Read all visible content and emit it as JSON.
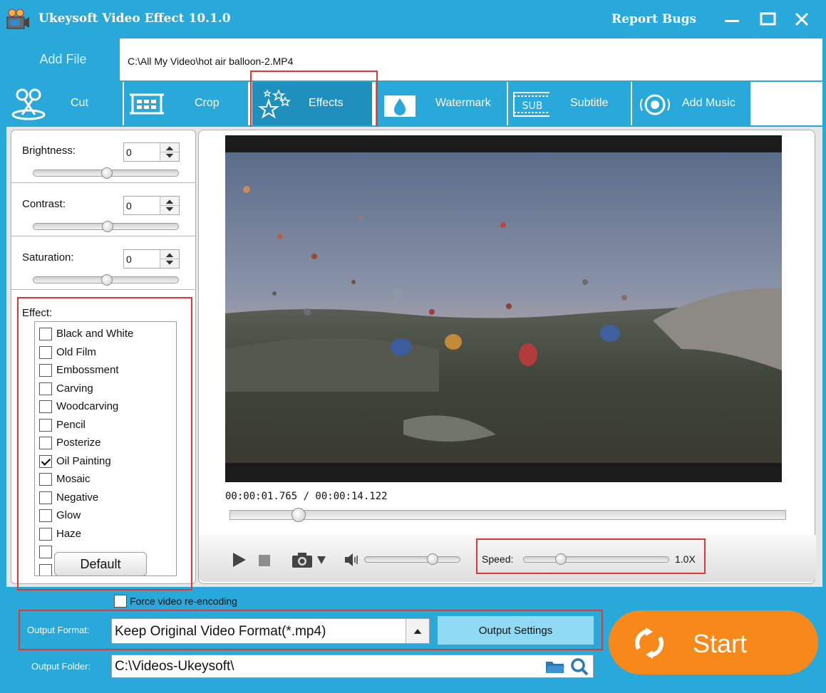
{
  "titlebar": {
    "title": "Ukeysoft Video Effect 10.1.0",
    "report_bugs": "Report Bugs"
  },
  "file": {
    "add_label": "Add File",
    "path": "C:\\All My Video\\hot air balloon-2.MP4"
  },
  "tabs": [
    {
      "label": "Cut",
      "icon": "scissors-icon"
    },
    {
      "label": "Crop",
      "icon": "crop-icon"
    },
    {
      "label": "Effects",
      "icon": "stars-icon",
      "active": true
    },
    {
      "label": "Watermark",
      "icon": "water-drop-icon"
    },
    {
      "label": "Subtitle",
      "icon": "subtitle-icon"
    },
    {
      "label": "Add Music",
      "icon": "music-target-icon"
    }
  ],
  "adjust": {
    "brightness": {
      "label": "Brightness:",
      "value": "0"
    },
    "contrast": {
      "label": "Contrast:",
      "value": "0"
    },
    "saturation": {
      "label": "Saturation:",
      "value": "0"
    }
  },
  "effects": {
    "title": "Effect:",
    "items": [
      {
        "label": "Black and White",
        "checked": false
      },
      {
        "label": "Old Film",
        "checked": false
      },
      {
        "label": "Embossment",
        "checked": false
      },
      {
        "label": "Carving",
        "checked": false
      },
      {
        "label": "Woodcarving",
        "checked": false
      },
      {
        "label": "Pencil",
        "checked": false
      },
      {
        "label": "Posterize",
        "checked": false
      },
      {
        "label": "Oil Painting",
        "checked": true
      },
      {
        "label": "Mosaic",
        "checked": false
      },
      {
        "label": "Negative",
        "checked": false
      },
      {
        "label": "Glow",
        "checked": false
      },
      {
        "label": "Haze",
        "checked": false
      }
    ],
    "default_label": "Default"
  },
  "player": {
    "timecode": "00:00:01.765 / 00:00:14.122",
    "speed_label": "Speed:",
    "speed_value": "1.0X"
  },
  "bottom": {
    "force_label": "Force video re-encoding",
    "output_format_label": "Output Format:",
    "output_format_value": "Keep Original Video Format(*.mp4)",
    "output_settings_label": "Output Settings",
    "output_folder_label": "Output Folder:",
    "output_folder_value": "C:\\Videos-Ukeysoft\\",
    "start_label": "Start"
  },
  "colors": {
    "accent": "#29a9d9",
    "start": "#f7891b",
    "highlight": "#e5362f"
  }
}
